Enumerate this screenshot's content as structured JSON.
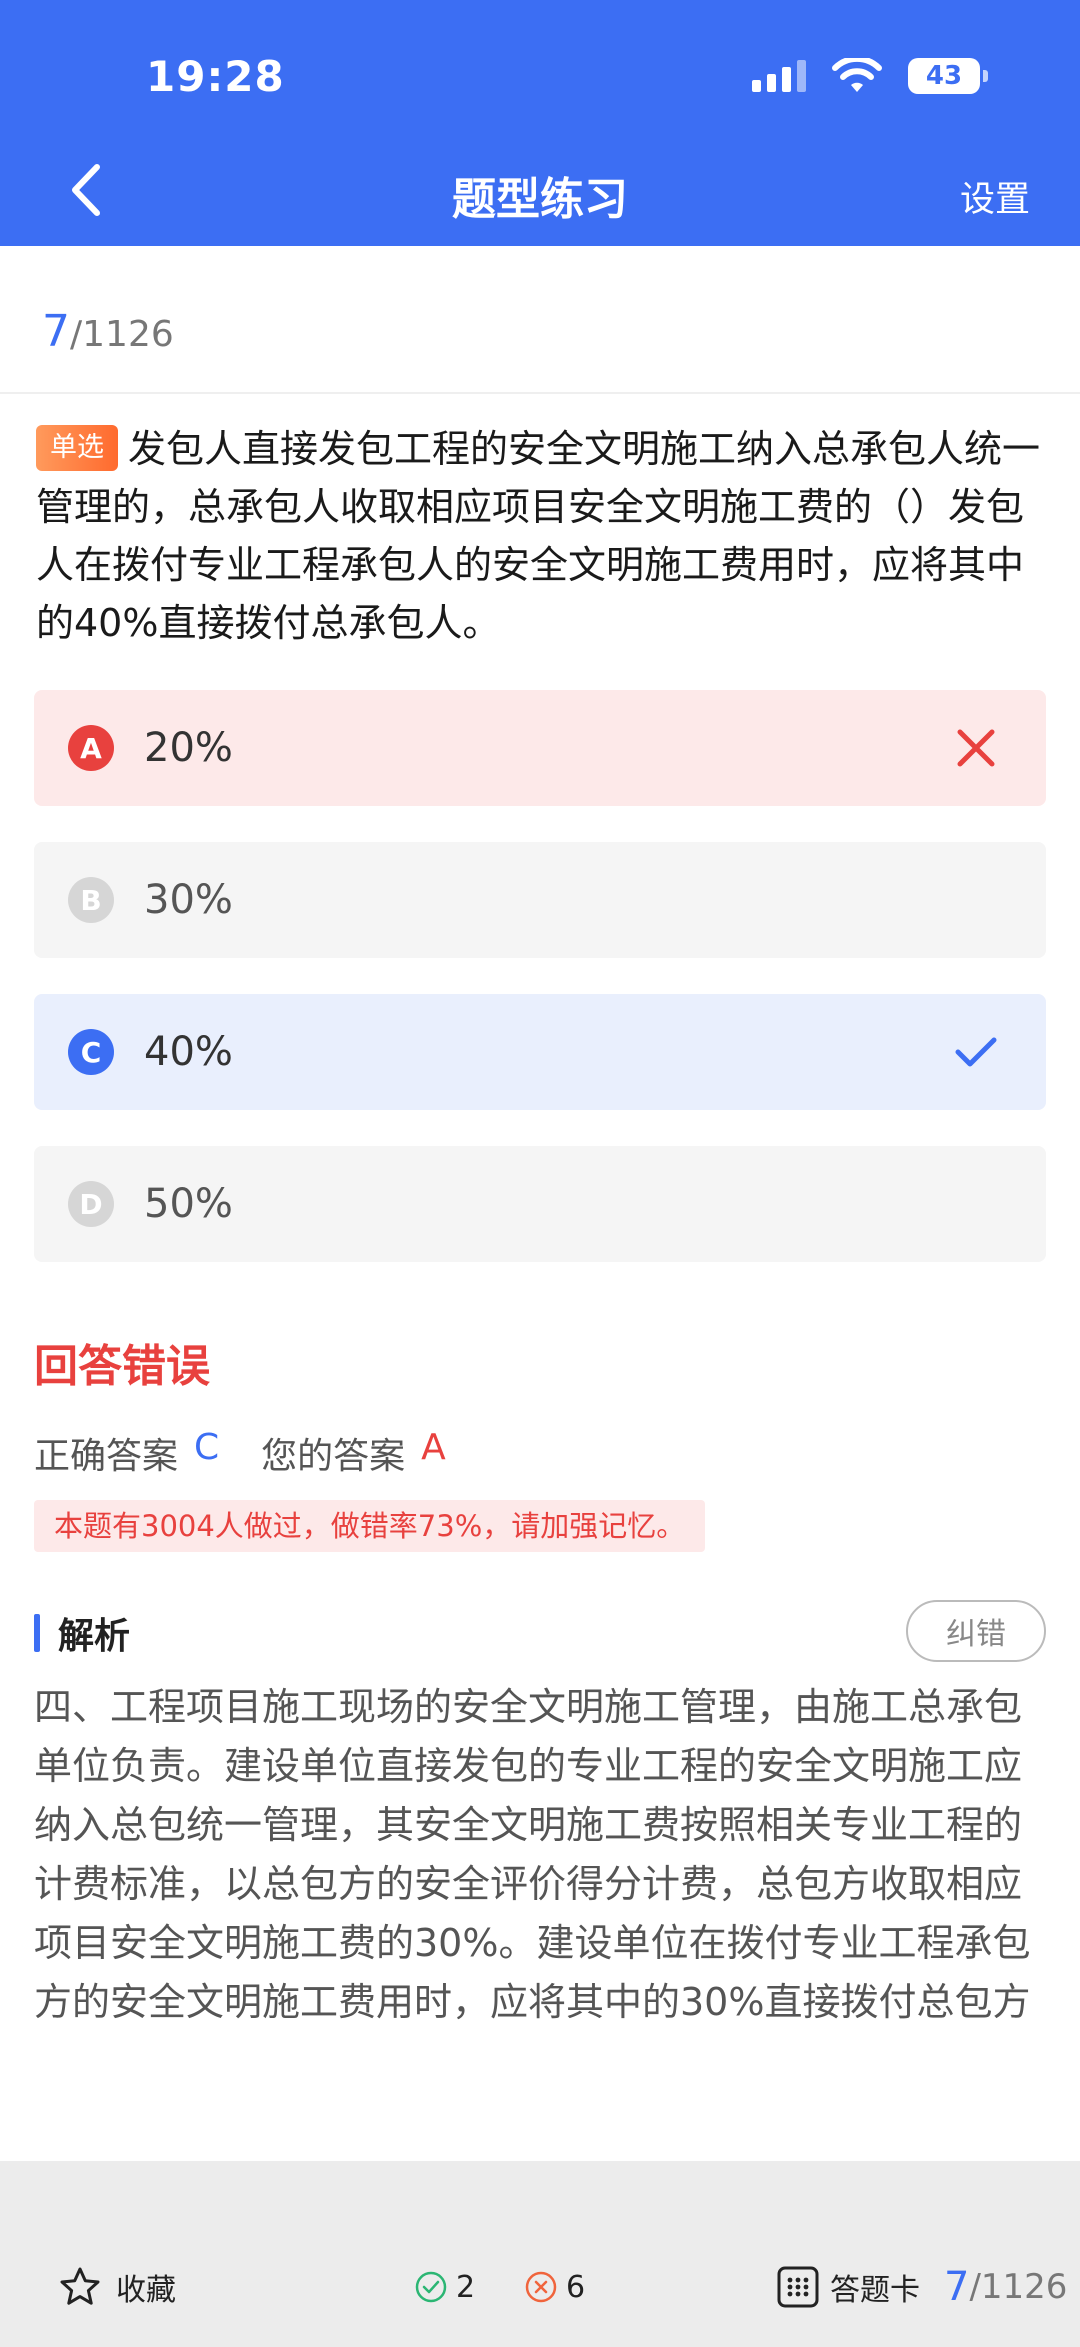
{
  "status_bar": {
    "time": "19:28",
    "battery": "43"
  },
  "nav": {
    "title": "题型练习",
    "settings_label": "设置"
  },
  "progress": {
    "current": "7",
    "total": "/1126"
  },
  "question": {
    "type_badge": "单选",
    "text": "发包人直接发包工程的安全文明施工纳入总承包人统一管理的，总承包人收取相应项目安全文明施工费的（）发包人在拨付专业工程承包人的安全文明施工费用时，应将其中的40%直接拨付总承包人。"
  },
  "options": [
    {
      "letter": "A",
      "text": "20%",
      "state": "wrong"
    },
    {
      "letter": "B",
      "text": "30%",
      "state": "neutral"
    },
    {
      "letter": "C",
      "text": "40%",
      "state": "correct"
    },
    {
      "letter": "D",
      "text": "50%",
      "state": "neutral"
    }
  ],
  "result": {
    "title": "回答错误",
    "correct_label": "正确答案",
    "correct_value": "C",
    "yours_label": "您的答案",
    "yours_value": "A",
    "hint": "本题有3004人做过，做错率73%，请加强记忆。"
  },
  "analysis": {
    "title": "解析",
    "report_label": "纠错",
    "body": "四、工程项目施工现场的安全文明施工管理，由施工总承包单位负责。建设单位直接发包的专业工程的安全文明施工应纳入总包统一管理，其安全文明施工费按照相关专业工程的计费标准，以总包方的安全评价得分计费，总包方收取相应项目安全文明施工费的30%。建设单位在拨付专业工程承包方的安全文明施工费用时，应将其中的30%直接拨付总包方"
  },
  "bottom_bar": {
    "favorite_label": "收藏",
    "right_count": "2",
    "wrong_count": "6",
    "card_label": "答题卡",
    "progress_current": "7",
    "progress_total": "/1126"
  },
  "colors": {
    "primary": "#3c6ef3",
    "error": "#e8413e",
    "badge": "#ff7a3c"
  }
}
